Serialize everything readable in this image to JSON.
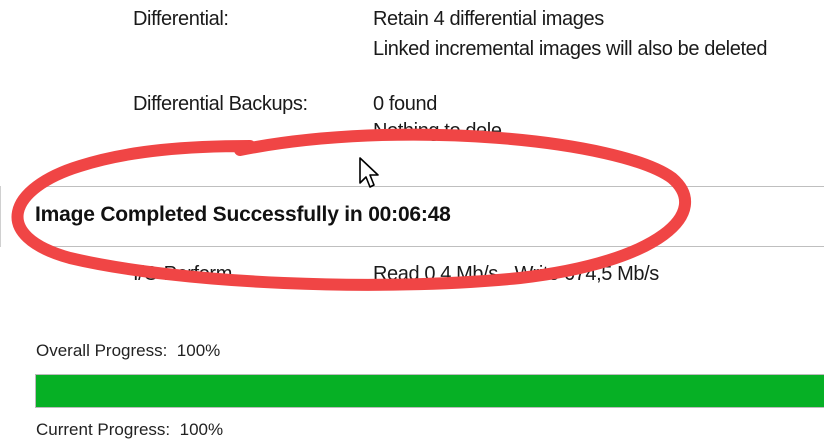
{
  "details": {
    "differential": {
      "label": "Differential:",
      "value_line1": "Retain 4 differential images",
      "value_line2": "Linked incremental images will also be deleted"
    },
    "differential_backups": {
      "label": "Differential Backups:",
      "value_line1": "0 found",
      "value_line2": "Nothing to dele"
    },
    "io_performance": {
      "label": "I/O Perform",
      "value": "Read 0,4 Mb/s - Write 674,5 Mb/s"
    }
  },
  "status": {
    "completed_message": "Image Completed Successfully in 00:06:48"
  },
  "progress": {
    "overall_label": "Overall Progress:",
    "overall_percent_text": "100%",
    "overall_fraction": 1.0,
    "current_label": "Current Progress:",
    "current_percent_text": "100%",
    "fill_color": "#06b025"
  },
  "annotation": {
    "ellipse_color": "#f04545",
    "cursor_icon": "arrow-cursor-icon"
  }
}
